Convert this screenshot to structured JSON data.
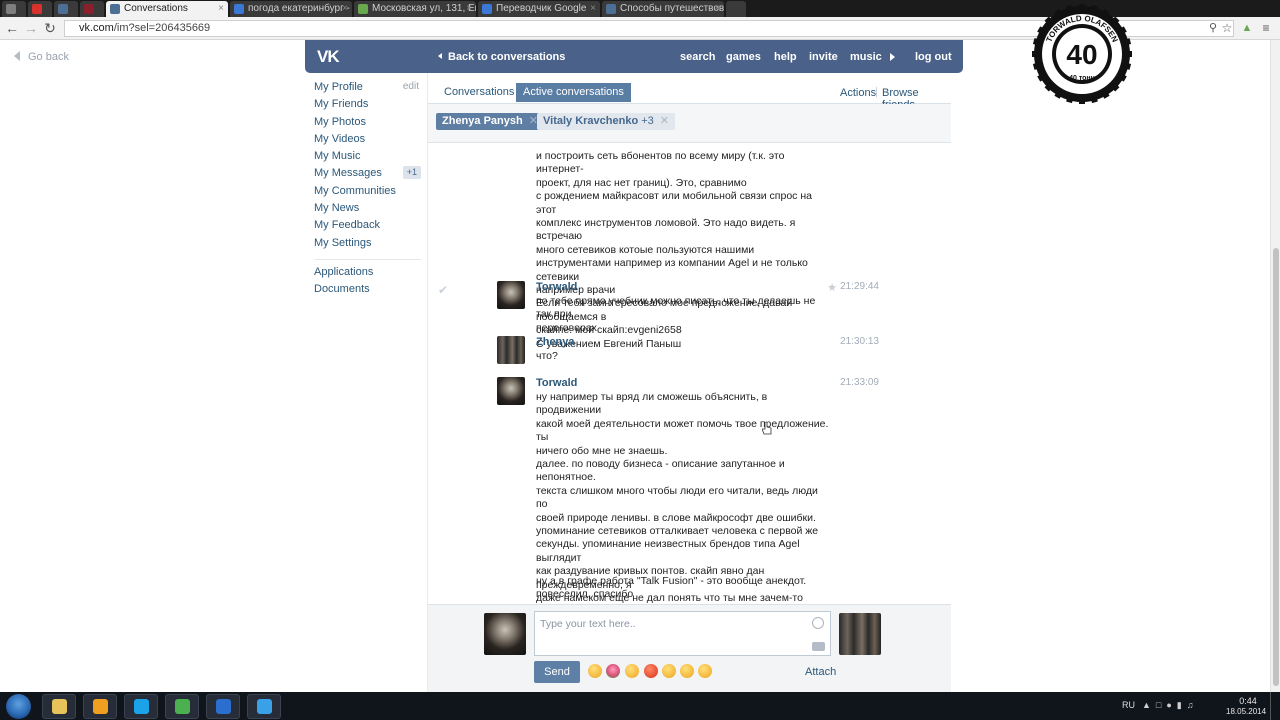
{
  "browser": {
    "tabs": [
      {
        "label": "",
        "color": "#7f7f7f"
      },
      {
        "label": "",
        "color": "#d9322c"
      },
      {
        "label": "",
        "color": "#4e6f95"
      },
      {
        "label": "",
        "color": "#8b1f2c"
      },
      {
        "label": "Conversations",
        "color": "#4e6f95"
      },
      {
        "label": "погода екатеринбург - П",
        "color": "#3a78d6"
      },
      {
        "label": "Московская ул, 131, Екат",
        "color": "#6aa84f"
      },
      {
        "label": "Переводчик Google",
        "color": "#3a78d6"
      },
      {
        "label": "Способы путешествоват",
        "color": "#4e6f95"
      }
    ],
    "url_host": "vk.com",
    "url_path": "/im?sel=206435669"
  },
  "badge": {
    "top_text": "TORWALD OLAFSEN",
    "number": "40",
    "bottom_text": "40 тонн"
  },
  "page": {
    "go_back": "Go back"
  },
  "header": {
    "logo": "VK",
    "back_to_conversations": "Back to conversations",
    "links": {
      "search": "search",
      "games": "games",
      "help": "help",
      "invite": "invite",
      "music": "music",
      "logout": "log out"
    }
  },
  "sidebar": {
    "items": [
      {
        "label": "My Profile",
        "extra": "edit"
      },
      {
        "label": "My Friends"
      },
      {
        "label": "My Photos"
      },
      {
        "label": "My Videos"
      },
      {
        "label": "My Music"
      },
      {
        "label": "My Messages",
        "count": "+1"
      },
      {
        "label": "My Communities"
      },
      {
        "label": "My News"
      },
      {
        "label": "My Feedback"
      },
      {
        "label": "My Settings"
      }
    ],
    "extra": [
      {
        "label": "Applications"
      },
      {
        "label": "Documents"
      }
    ]
  },
  "tabs": {
    "conversations": "Conversations",
    "active": "Active conversations",
    "actions": "Actions",
    "browse_friends": "Browse friends"
  },
  "peers": {
    "active": "Zhenya Panysh",
    "inactive": "Vitaly Kravchenko",
    "inactive_more": "+3"
  },
  "messages": [
    {
      "author": "",
      "time": "",
      "text": "и построить сеть вбонентов по всему миру (т.к. это интернет-\nпроект, для нас нет границ). Это, сравнимо\nс рождением майкрасовт или мобильной связи спрос на этот\nкомплекс инструментов ломовой. Это надо видеть. я встречаю\nмного сетевиков котоые пользуются нашими\nинструментами например из компании Agel и не только сетевики\nнапример врачи\nЕсли тебя заинтересовало мое предложение, давай пообщаемся в\nскайпе. мой скайп:evgeni2658\nС уважением Евгений Паныш"
    },
    {
      "author": "Torwald",
      "time": "21:29:44",
      "text": "по тебе прямо учебник можно писать, что ты делаешь не так при\nпереговорах"
    },
    {
      "author": "Zhenya",
      "time": "21:30:13",
      "text": "что?"
    },
    {
      "author": "Torwald",
      "time": "21:33:09",
      "text": "ну например ты вряд ли сможешь объяснить, в продвижении\nкакой моей деятельности может помочь твое предложение. ты\nничего обо мне не знаешь.\nдалее. по поводу бизнеса - описание запутанное и непонятное.\nтекста слишком много чтобы люди его читали, ведь люди по\nсвоей природе ленивы. в слове майкрософт две ошибки.\nупоминание сетевиков отталкивает человека с первой же\nсекунды. упоминание неизвестных брендов типа Agel выглядит\nкак раздувание кривых понтов. скайп явно дан преждевременно, я\nдаже намеком еще не дал понять что ты мне зачем-то нужен.\n\nи последнее, фраза \"с уважением...\" - очевидная ложь. тебе на\nменя плевать, тебя интересуют только деньги"
    },
    {
      "author": "",
      "time": "",
      "text": "ну а в графе работа \"Talk Fusion\" - это вообще анекдот.\nповеселил, спасибо"
    }
  ],
  "composer": {
    "placeholder": "Type your text here..",
    "send": "Send",
    "attach": "Attach"
  },
  "taskbar": {
    "apps": [
      {
        "name": "explorer",
        "color": "#e8c35a"
      },
      {
        "name": "media-player",
        "color": "#f0a020"
      },
      {
        "name": "skype",
        "color": "#1aa3e8"
      },
      {
        "name": "chrome",
        "color": "#4caf50"
      },
      {
        "name": "video-app",
        "color": "#2a6fd0"
      },
      {
        "name": "triangle-app",
        "color": "#3aa0e8"
      }
    ],
    "lang": "RU",
    "time": "0:44",
    "date": "18.05.2014"
  }
}
